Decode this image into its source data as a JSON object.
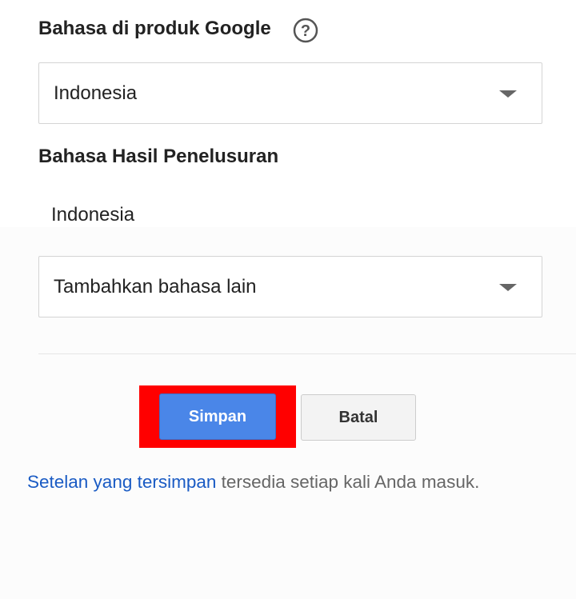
{
  "product_language": {
    "heading": "Bahasa di produk Google",
    "help_icon": "help-circle-icon",
    "selected": "Indonesia"
  },
  "search_language": {
    "heading": "Bahasa Hasil Penelusuran",
    "languages": [
      "Indonesia"
    ],
    "add_language_selected": "Tambahkan bahasa lain"
  },
  "actions": {
    "save_label": "Simpan",
    "cancel_label": "Batal"
  },
  "footer": {
    "link_text": "Setelan yang tersimpan",
    "text": " tersedia setiap kali Anda masuk."
  },
  "colors": {
    "primary_button": "#4a86e8",
    "highlight": "#ff0000",
    "link": "#1a5bc4"
  }
}
